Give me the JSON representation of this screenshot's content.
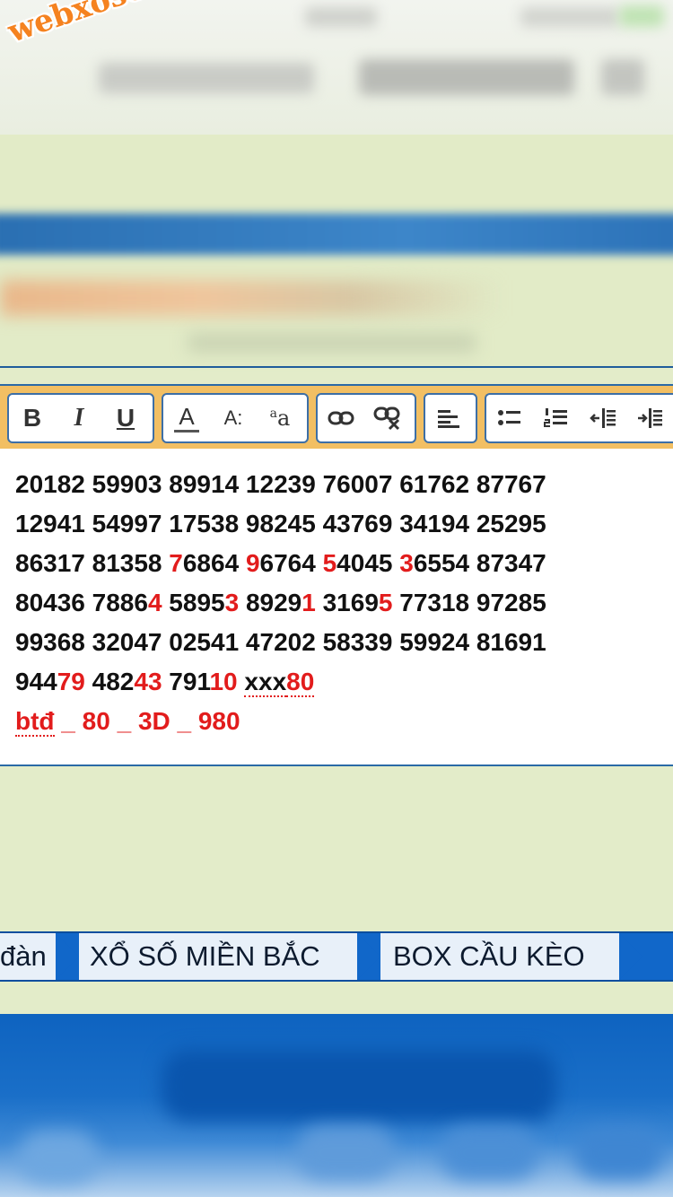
{
  "watermark": "webxoso.net",
  "toolbar": {
    "buttons": [
      {
        "name": "bold-button",
        "label": "B"
      },
      {
        "name": "italic-button",
        "label": "I"
      },
      {
        "name": "underline-button",
        "label": "U"
      },
      {
        "name": "font-color-button",
        "label": "A"
      },
      {
        "name": "font-size-button",
        "label": "A:"
      },
      {
        "name": "font-family-button",
        "label": "a"
      },
      {
        "name": "insert-link-button",
        "icon": "link-icon"
      },
      {
        "name": "remove-link-button",
        "icon": "unlink-icon"
      },
      {
        "name": "align-left-button",
        "icon": "align-left-icon"
      },
      {
        "name": "bullet-list-button",
        "icon": "bullet-list-icon"
      },
      {
        "name": "numbered-list-button",
        "icon": "numbered-list-icon"
      },
      {
        "name": "outdent-button",
        "icon": "outdent-icon"
      },
      {
        "name": "indent-button",
        "icon": "indent-icon"
      }
    ]
  },
  "editor": {
    "lines": [
      [
        {
          "t": "20182 59903 89914 12239 76007 61762 87767",
          "red": false
        }
      ],
      [
        {
          "t": "12941 54997 17538 98245 43769 34194 25295",
          "red": false
        }
      ],
      [
        {
          "t": "86317 81358 ",
          "red": false
        },
        {
          "t": "7",
          "red": true
        },
        {
          "t": "6864 ",
          "red": false
        },
        {
          "t": "9",
          "red": true
        },
        {
          "t": "6764 ",
          "red": false
        },
        {
          "t": "5",
          "red": true
        },
        {
          "t": "4045 ",
          "red": false
        },
        {
          "t": "3",
          "red": true
        },
        {
          "t": "6554 87347",
          "red": false
        }
      ],
      [
        {
          "t": "80436 7886",
          "red": false
        },
        {
          "t": "4",
          "red": true
        },
        {
          "t": " 5895",
          "red": false
        },
        {
          "t": "3",
          "red": true
        },
        {
          "t": " 8929",
          "red": false
        },
        {
          "t": "1",
          "red": true
        },
        {
          "t": " 3169",
          "red": false
        },
        {
          "t": "5",
          "red": true
        },
        {
          "t": " 77318 97285",
          "red": false
        }
      ],
      [
        {
          "t": "99368 32047 02541 47202 58339 59924 81691",
          "red": false
        }
      ],
      [
        {
          "t": "944",
          "red": false
        },
        {
          "t": "79",
          "red": true
        },
        {
          "t": " 482",
          "red": false
        },
        {
          "t": "43",
          "red": true
        },
        {
          "t": " 791",
          "red": false
        },
        {
          "t": "10",
          "red": true
        },
        {
          "t": " ",
          "red": false
        },
        {
          "t": "xxx",
          "red": false,
          "squiggle": true
        },
        {
          "t": "80",
          "red": true,
          "squiggle": true
        }
      ],
      [
        {
          "t": "btđ",
          "red": true,
          "squiggle": true
        },
        {
          "t": " _ 80 _ 3D _ 980",
          "red": true
        }
      ]
    ]
  },
  "nav": {
    "items": [
      "đàn",
      "XỔ SỐ MIỀN BẮC",
      "BOX CẦU KÈO"
    ]
  },
  "colors": {
    "toolbar_bg": "#f2bf63",
    "nav_blue": "#1167c9",
    "accent_red": "#e21c1c",
    "page_green": "#e3ecc9",
    "watermark_orange": "#f5821f"
  }
}
